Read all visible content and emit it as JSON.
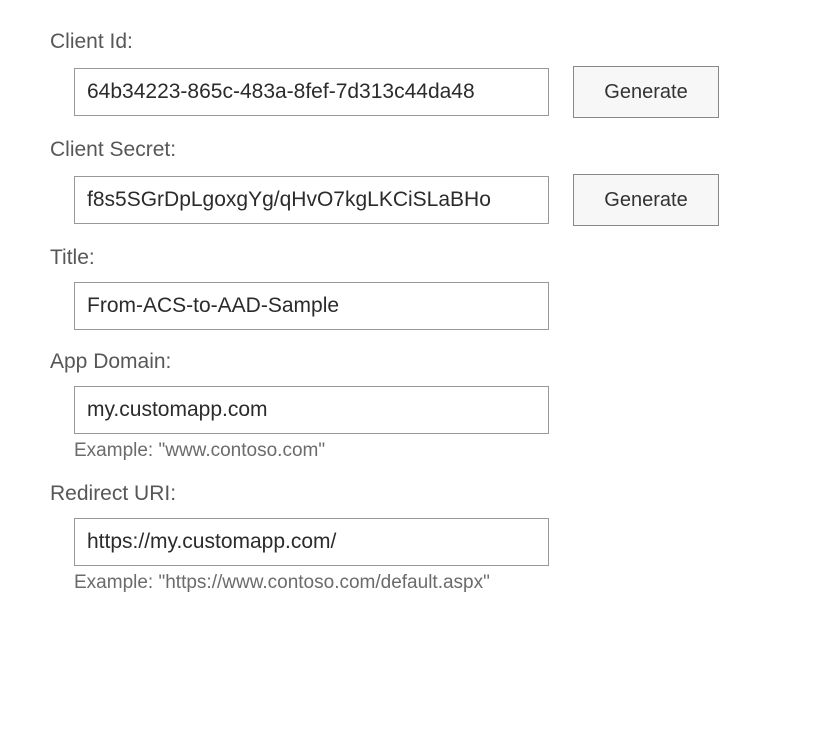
{
  "fields": {
    "client_id": {
      "label": "Client Id:",
      "value": "64b34223-865c-483a-8fef-7d313c44da48",
      "generate_label": "Generate"
    },
    "client_secret": {
      "label": "Client Secret:",
      "value": "f8s5SGrDpLgoxgYg/qHvO7kgLKCiSLaBHo",
      "generate_label": "Generate"
    },
    "title": {
      "label": "Title:",
      "value": "From-ACS-to-AAD-Sample"
    },
    "app_domain": {
      "label": "App Domain:",
      "value": "my.customapp.com",
      "hint": "Example: \"www.contoso.com\""
    },
    "redirect_uri": {
      "label": "Redirect URI:",
      "value": "https://my.customapp.com/",
      "hint": "Example: \"https://www.contoso.com/default.aspx\""
    }
  }
}
